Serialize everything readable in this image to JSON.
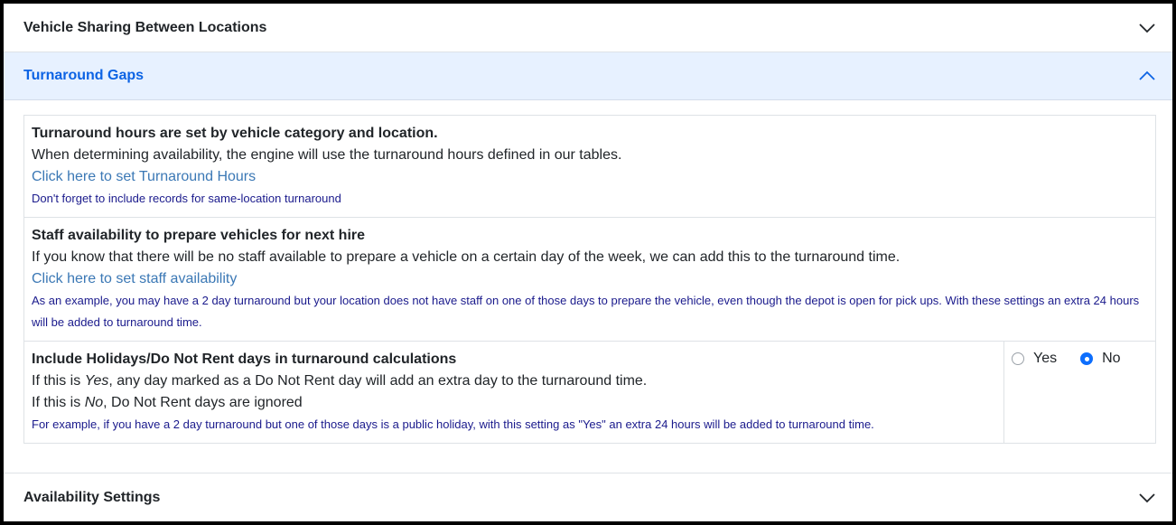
{
  "accordion": {
    "vehicle_sharing": {
      "label": "Vehicle Sharing Between Locations",
      "icon": "chevron-down-icon"
    },
    "turnaround_gaps": {
      "label": "Turnaround Gaps",
      "icon": "chevron-up-icon"
    },
    "availability_settings": {
      "label": "Availability Settings",
      "icon": "chevron-down-icon"
    }
  },
  "turnaround_hours": {
    "title": "Turnaround hours are set by vehicle category and location.",
    "description": "When determining availability, the engine will use the turnaround hours defined in our tables.",
    "link": "Click here to set Turnaround Hours",
    "note": "Don't forget to include records for same-location turnaround"
  },
  "staff_availability": {
    "title": "Staff availability to prepare vehicles for next hire",
    "description": "If you know that there will be no staff available to prepare a vehicle on a certain day of the week, we can add this to the turnaround time.",
    "link": "Click here to set staff availability",
    "note": "As an example, you may have a 2 day turnaround but your location does not have staff on one of those days to prepare the vehicle, even though the depot is open for pick ups. With these settings an extra 24 hours will be added to turnaround time."
  },
  "holidays": {
    "title": "Include Holidays/Do Not Rent days in turnaround calculations",
    "line1_prefix": "If this is ",
    "line1_em": "Yes",
    "line1_suffix": ", any day marked as a Do Not Rent day will add an extra day to the turnaround time.",
    "line2_prefix": "If this is ",
    "line2_em": "No",
    "line2_suffix": ", Do Not Rent days are ignored",
    "note": "For example, if you have a 2 day turnaround but one of those days is a public holiday, with this setting as \"Yes\" an extra 24 hours will be added to turnaround time.",
    "options": {
      "yes": "Yes",
      "no": "No"
    },
    "selected": "No"
  },
  "colors": {
    "accent": "#0d6efd",
    "active_header_bg": "#e7f1ff",
    "active_header_text": "#0c63e4",
    "link": "#3b78b5",
    "note": "#1a1a8c"
  }
}
